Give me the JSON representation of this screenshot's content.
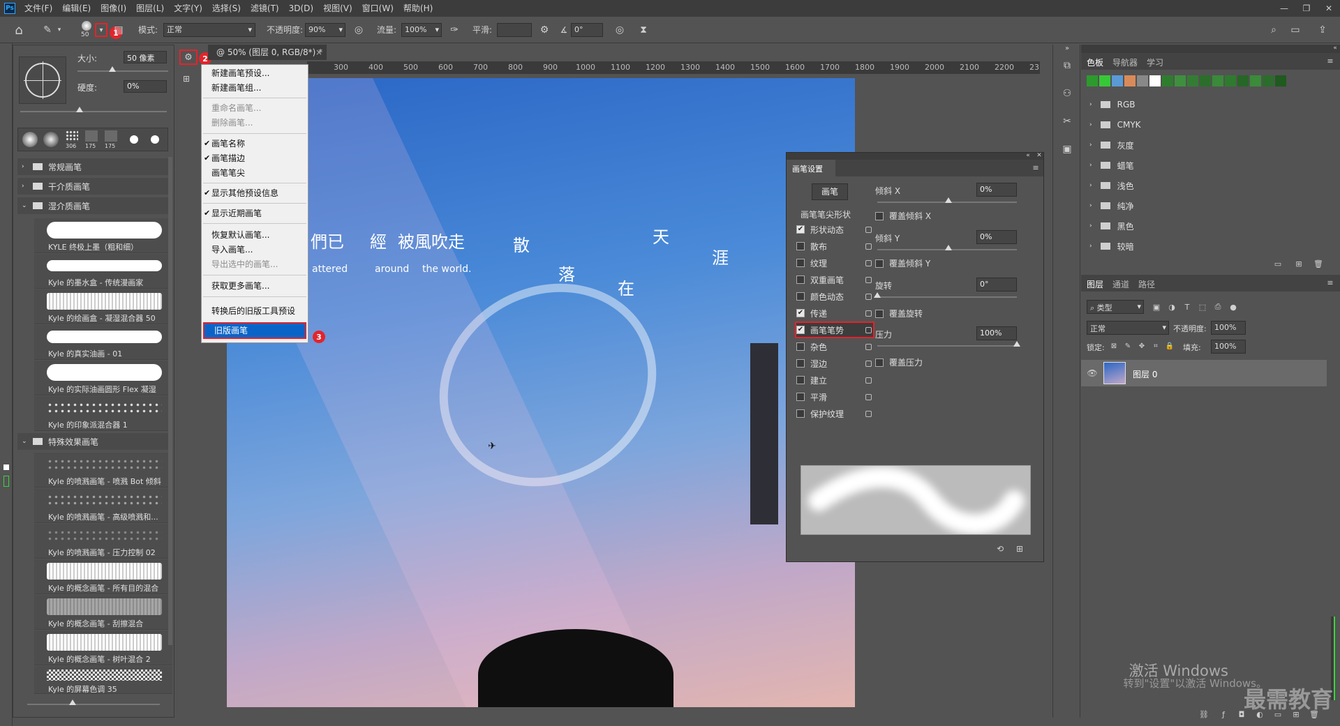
{
  "menubar": {
    "app_logo": "Ps",
    "items": [
      "文件(F)",
      "编辑(E)",
      "图像(I)",
      "图层(L)",
      "文字(Y)",
      "选择(S)",
      "滤镜(T)",
      "3D(D)",
      "视图(V)",
      "窗口(W)",
      "帮助(H)"
    ]
  },
  "options": {
    "brush_size": "50",
    "mode_label": "模式:",
    "mode_value": "正常",
    "opacity_label": "不透明度:",
    "opacity_value": "90%",
    "flow_label": "流量:",
    "flow_value": "100%",
    "smooth_label": "平滑:",
    "angle_value": "0°"
  },
  "badges": {
    "b1": "1",
    "b2": "2",
    "b3": "3"
  },
  "brush_panel": {
    "size_label": "大小:",
    "size_value": "50 像素",
    "hardness_label": "硬度:",
    "hardness_value": "0%",
    "preset_nums": [
      "306",
      "175",
      "175"
    ],
    "folders": [
      "常规画笔",
      "干介质画笔",
      "湿介质画笔",
      "特殊效果画笔"
    ],
    "wet_strokes": [
      "KYLE 终极上墨（粗和细）",
      "Kyle 的墨水盒 - 传统漫画家",
      "Kyle 的绘画盒 - 凝湿混合器 50",
      "Kyle 的真实油画 - 01",
      "Kyle 的实际油画圆形 Flex 凝湿",
      "Kyle 的印象派混合器 1"
    ],
    "fx_strokes": [
      "Kyle 的喷溅画笔 - 喷溅 Bot 倾斜",
      "Kyle 的喷溅画笔 - 高级喷溅和...",
      "Kyle 的喷溅画笔 - 压力控制 02",
      "Kyle 的概念画笔 - 所有目的混合",
      "Kyle 的概念画笔 - 刮擦混合",
      "Kyle 的概念画笔 - 树叶混合 2",
      "Kyle 的屏幕色调 35"
    ]
  },
  "context_menu": {
    "items": [
      "新建画笔预设...",
      "新建画笔组...",
      "重命名画笔...",
      "删除画笔...",
      "画笔名称",
      "画笔描边",
      "画笔笔尖",
      "显示其他预设信息",
      "显示近期画笔",
      "恢复默认画笔...",
      "导入画笔...",
      "导出选中的画笔...",
      "获取更多画笔...",
      "转换后的旧版工具预设",
      "旧版画笔"
    ]
  },
  "document": {
    "tab_title": "@ 50% (图层 0, RGB/8*) *",
    "ruler_ticks": [
      "300",
      "400",
      "500",
      "600",
      "700",
      "800",
      "900",
      "1000",
      "1100",
      "1200",
      "1300",
      "1400",
      "1500",
      "1600",
      "1700",
      "1800",
      "1900",
      "2000",
      "2100",
      "2200",
      "23"
    ]
  },
  "canvas_text": {
    "line1": [
      "們已",
      "經",
      "被風吹走",
      "散",
      "天"
    ],
    "line2": [
      "落",
      "在",
      "涯"
    ],
    "eng": [
      "attered",
      "around",
      "the world."
    ]
  },
  "brush_settings": {
    "title": "画笔设置",
    "button": "画笔",
    "tip_shape": "画笔笔尖形状",
    "items": [
      {
        "label": "形状动态",
        "checked": true
      },
      {
        "label": "散布",
        "checked": false
      },
      {
        "label": "纹理",
        "checked": false
      },
      {
        "label": "双重画笔",
        "checked": false
      },
      {
        "label": "颜色动态",
        "checked": false
      },
      {
        "label": "传递",
        "checked": true
      },
      {
        "label": "画笔笔势",
        "checked": true
      },
      {
        "label": "杂色",
        "checked": false
      },
      {
        "label": "湿边",
        "checked": false
      },
      {
        "label": "建立",
        "checked": false
      },
      {
        "label": "平滑",
        "checked": false
      },
      {
        "label": "保护纹理",
        "checked": false
      }
    ],
    "tilt_x_label": "倾斜 X",
    "tilt_x_value": "0%",
    "override_tilt_x": "覆盖倾斜 X",
    "tilt_y_label": "倾斜 Y",
    "tilt_y_value": "0%",
    "override_tilt_y": "覆盖倾斜 Y",
    "rotation_label": "旋转",
    "rotation_value": "0°",
    "override_rotation": "覆盖旋转",
    "pressure_label": "压力",
    "pressure_value": "100%",
    "override_pressure": "覆盖压力"
  },
  "swatches": {
    "tabs": [
      "色板",
      "导航器",
      "学习"
    ],
    "colors": [
      "#2d9a2d",
      "#37c837",
      "#5a9ad6",
      "#d98a5a",
      "#888888",
      "#ffffff",
      "#2e7d2e",
      "#3f8f3f",
      "#347c34",
      "#2b6e2b",
      "#3a8a3a",
      "#2f7a2f",
      "#266626",
      "#3b8b3b",
      "#2c6c2c",
      "#1f5a1f"
    ],
    "folders": [
      "RGB",
      "CMYK",
      "灰度",
      "蜡笔",
      "浅色",
      "纯净",
      "黑色",
      "较暗"
    ]
  },
  "layers": {
    "tabs": [
      "图层",
      "通道",
      "路径"
    ],
    "filter_label": "类型",
    "blend_value": "正常",
    "opacity_label": "不透明度:",
    "opacity_value": "100%",
    "lock_label": "锁定:",
    "fill_label": "填充:",
    "fill_value": "100%",
    "layer_name": "图层 0"
  },
  "watermark": {
    "activate": "激活 Windows",
    "activate_sub": "转到\"设置\"以激活 Windows。",
    "logo": "最需教育"
  }
}
